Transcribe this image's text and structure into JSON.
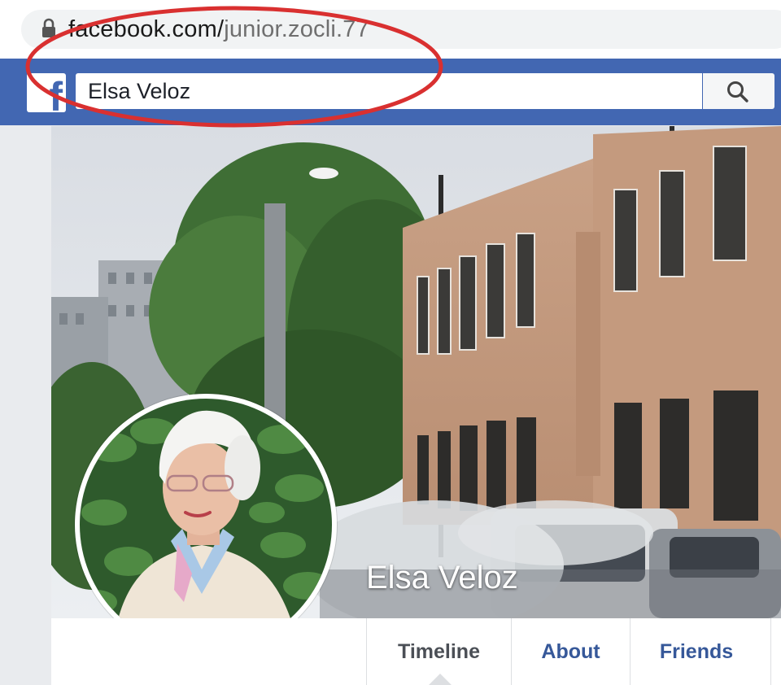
{
  "browser": {
    "url_domain": "facebook.com/",
    "url_path": "junior.zocli.77",
    "lock_icon": "lock-icon"
  },
  "header": {
    "logo_glyph": "f",
    "search_value": "Elsa Veloz",
    "search_icon": "search-icon",
    "brand_color": "#4267b2"
  },
  "annotation": {
    "shape": "red-ellipse",
    "color": "#d93030"
  },
  "profile": {
    "name": "Elsa Veloz"
  },
  "tabs": [
    {
      "label": "Timeline",
      "active": true
    },
    {
      "label": "About",
      "active": false
    },
    {
      "label": "Friends",
      "active": false
    }
  ]
}
